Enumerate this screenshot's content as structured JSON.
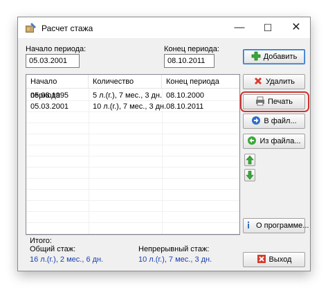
{
  "window": {
    "title": "Расчет стажа",
    "min_glyph": "—",
    "max_glyph": "☐",
    "close_glyph": "✕"
  },
  "period": {
    "start_label": "Начало периода:",
    "start_value": "05.03.2001",
    "end_label": "Конец периода:",
    "end_value": "08.10.2011"
  },
  "table": {
    "headers": [
      "Начало периода",
      "Количество",
      "Конец периода"
    ],
    "rows": [
      [
        "05.03.1995",
        "5 л.(г.), 7 мес., 3 дн.",
        "08.10.2000"
      ],
      [
        "05.03.2001",
        "10 л.(г.), 7 мес., 3 дн.",
        "08.10.2011"
      ]
    ]
  },
  "summary": {
    "title": "Итого:",
    "total_label": "Общий стаж:",
    "total_value": "16 л.(г.), 2 мес., 6 дн.",
    "continuous_label": "Непрерывный стаж:",
    "continuous_value": "10 л.(г.), 7 мес., 3 дн."
  },
  "buttons": {
    "add": "Добавить",
    "delete": "Удалить",
    "print": "Печать",
    "to_file": "В файл...",
    "from_file": "Из файла...",
    "about": "О программе...",
    "exit": "Выход"
  },
  "colors": {
    "highlight": "#d0342c",
    "summary_values": "#1a3fb0",
    "add_icon": "#3aa83a",
    "delete_icon": "#d83a2a"
  }
}
